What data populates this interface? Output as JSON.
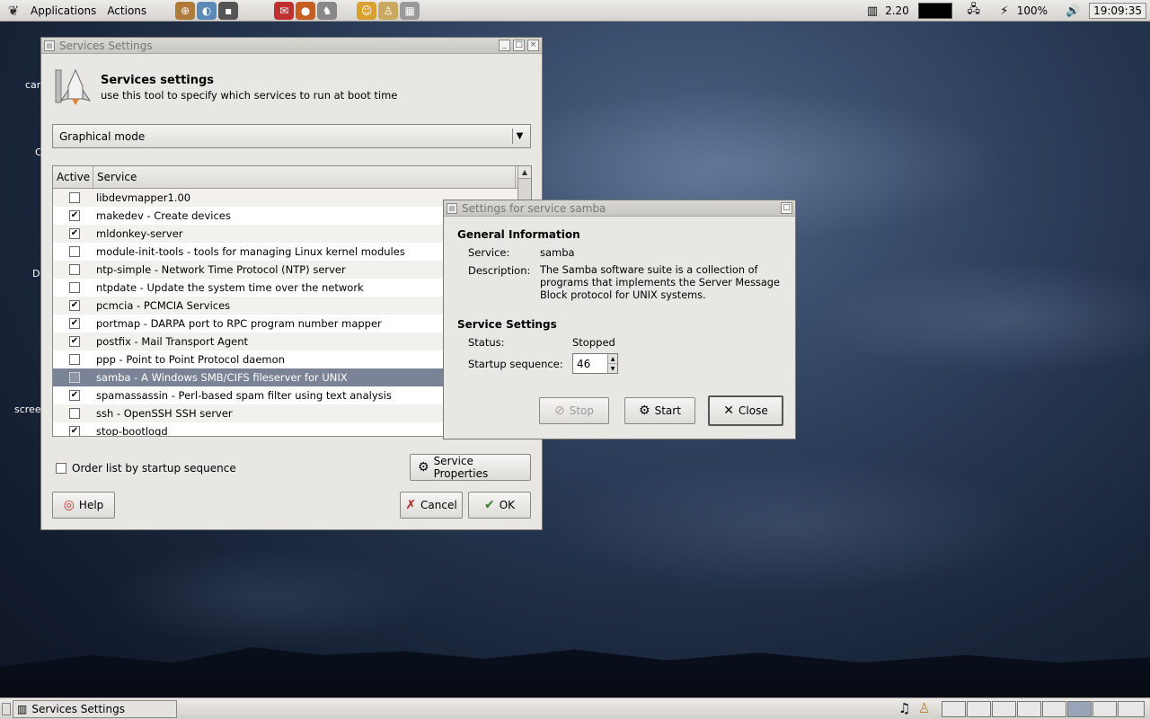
{
  "top_panel": {
    "menu": [
      "Applications",
      "Actions"
    ],
    "load": "2.20",
    "battery": "100%",
    "clock": "19:09:35"
  },
  "desktop_labels": [
    "car",
    "C",
    "D",
    "scree"
  ],
  "services_window": {
    "title": "Services Settings",
    "heading": "Services settings",
    "subheading": "use this tool to specify which services to run at boot time",
    "mode": "Graphical mode",
    "columns": [
      "Active",
      "Service"
    ],
    "services": [
      {
        "active": false,
        "label": "libdevmapper1.00"
      },
      {
        "active": true,
        "label": "makedev - Create devices"
      },
      {
        "active": true,
        "label": "mldonkey-server"
      },
      {
        "active": false,
        "label": "module-init-tools - tools for managing Linux kernel modules"
      },
      {
        "active": false,
        "label": "ntp-simple - Network Time Protocol (NTP) server"
      },
      {
        "active": false,
        "label": "ntpdate - Update the system time over the network"
      },
      {
        "active": true,
        "label": "pcmcia - PCMCIA Services"
      },
      {
        "active": true,
        "label": "portmap - DARPA port to RPC program number mapper"
      },
      {
        "active": true,
        "label": "postfix - Mail Transport Agent"
      },
      {
        "active": false,
        "label": "ppp - Point to Point Protocol daemon"
      },
      {
        "active": false,
        "label": "samba - A Windows SMB/CIFS fileserver for UNIX",
        "selected": true
      },
      {
        "active": true,
        "label": "spamassassin - Perl-based spam filter using text analysis"
      },
      {
        "active": false,
        "label": "ssh - OpenSSH SSH server"
      },
      {
        "active": true,
        "label": "stop-bootlogd"
      }
    ],
    "order_label": "Order list by startup sequence",
    "properties_btn": "Service Properties",
    "help_btn": "Help",
    "cancel_btn": "Cancel",
    "ok_btn": "OK"
  },
  "samba_dialog": {
    "title": "Settings for service samba",
    "general_heading": "General Information",
    "service_label": "Service:",
    "service_value": "samba",
    "description_label": "Description:",
    "description_value": "The Samba software suite is a collection of programs that implements the Server Message Block protocol for UNIX systems.",
    "settings_heading": "Service Settings",
    "status_label": "Status:",
    "status_value": "Stopped",
    "startup_label": "Startup sequence:",
    "startup_value": "46",
    "stop_btn": "Stop",
    "start_btn": "Start",
    "close_btn": "Close"
  },
  "taskbar": {
    "task": "Services Settings"
  }
}
